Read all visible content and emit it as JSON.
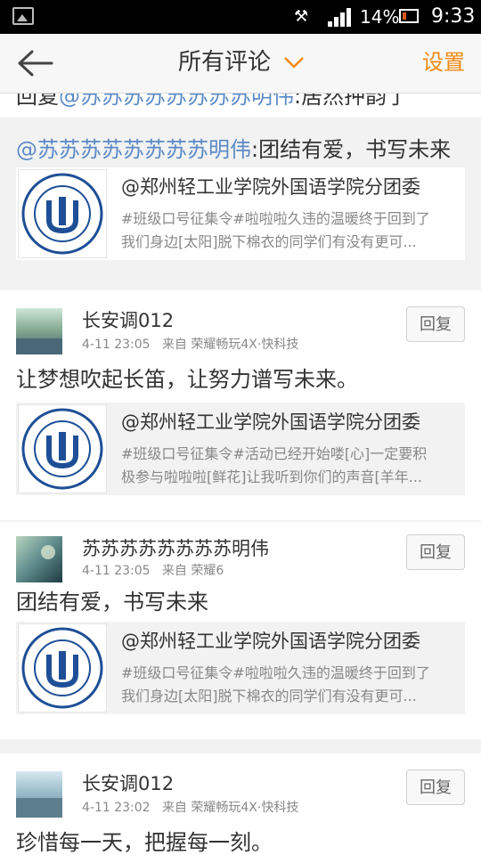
{
  "status_bar": {
    "battery": "14%",
    "time": "9:33"
  },
  "header": {
    "title": "所有评论",
    "settings": "设置"
  },
  "partial_top": {
    "prefix": "回复",
    "mention": "@苏苏苏苏苏苏苏苏明伟",
    "text": ":居然押韵了"
  },
  "comments": [
    {
      "reply_mention": "@苏苏苏苏苏苏苏苏明伟",
      "reply_text": ":团结有爱，书写未来",
      "quote": {
        "title": "@郑州轻工业学院外国语学院分团委",
        "line1": "#班级口号征集令#啦啦啦久违的温暖终于回到了",
        "line2": "我们身边[太阳]脱下棉衣的同学们有没有更可..."
      }
    },
    {
      "username": "长安调012",
      "date": "4-11 23:05",
      "source": "来自 荣耀畅玩4X·快科技",
      "reply_label": "回复",
      "text": "让梦想吹起长笛，让努力谱写未来。",
      "quote": {
        "title": "@郑州轻工业学院外国语学院分团委",
        "line1": "#班级口号征集令#活动已经开始喽[心]一定要积",
        "line2": "极参与啦啦啦[鲜花]让我听到你们的声音[羊年..."
      }
    },
    {
      "username": "苏苏苏苏苏苏苏苏明伟",
      "date": "4-11 23:05",
      "source": "来自 荣耀6",
      "reply_label": "回复",
      "text": "团结有爱，书写未来",
      "quote": {
        "title": "@郑州轻工业学院外国语学院分团委",
        "line1": "#班级口号征集令#啦啦啦久违的温暖终于回到了",
        "line2": "我们身边[太阳]脱下棉衣的同学们有没有更可..."
      }
    },
    {
      "username": "长安调012",
      "date": "4-11 23:02",
      "source": "来自 荣耀畅玩4X·快科技",
      "reply_label": "回复",
      "text": "珍惜每一天，把握每一刻。"
    }
  ],
  "colors": {
    "accent": "#f08a12",
    "mention": "#5b8ac6",
    "logo_blue": "#1e4f96"
  }
}
